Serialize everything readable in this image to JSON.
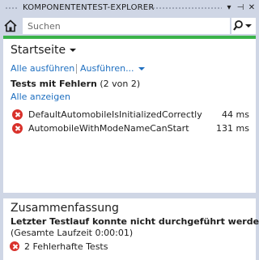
{
  "window": {
    "title": "KOMPONENTENTEST-EXPLORER",
    "dropdown_glyph": "▾",
    "pin_glyph": "⊣",
    "close_glyph": "✕"
  },
  "toolbar": {
    "search_placeholder": "Suchen",
    "home_icon": "home-icon",
    "search_icon": "search-icon"
  },
  "progress": {
    "value": 1.0,
    "color": "#3bb34a"
  },
  "main": {
    "page_title": "Startseite",
    "run_all": "Alle ausführen",
    "run_menu": "Ausführen...",
    "failed_group": {
      "title": "Tests mit Fehlern",
      "count": "(2 von 2)",
      "show_all": "Alle anzeigen",
      "tests": [
        {
          "name": "DefaultAutomobileIsInitializedCorrectly",
          "duration": "44 ms"
        },
        {
          "name": "AutomobileWithModeNameCanStart",
          "duration": "131 ms"
        }
      ]
    }
  },
  "summary": {
    "title": "Zusammenfassung",
    "message": "Letzter Testlauf konnte nicht durchgeführt werden.",
    "runtime": "(Gesamte Laufzeit 0:00:01)",
    "failed_count": "2 Fehlerhafte Tests"
  },
  "colors": {
    "accent_link": "#1e6fc0",
    "error": "#d9312b",
    "chrome": "#cfd6e5"
  }
}
